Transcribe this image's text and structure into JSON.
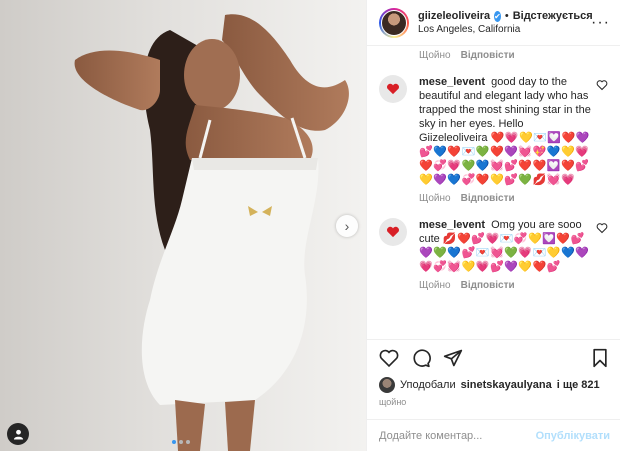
{
  "post": {
    "photo_alt": "photo",
    "carousel": {
      "count": 3,
      "active": 0
    }
  },
  "header": {
    "username": "giizeleoliveira",
    "verified_mark": "✔",
    "separator": "•",
    "follow_status": "Відстежується",
    "location": "Los Angeles, California",
    "more_label": "···"
  },
  "caption_meta": {
    "time": "Щойно",
    "reply": "Відповісти"
  },
  "comments": [
    {
      "username": "mese_levent",
      "text": "good day to the beautiful and elegant lady who has trapped the most shining star in the sky in her eyes. Hello Giizeleoliveira",
      "emojis": "❤️💗💛💌💟❤️💜💕💙❤️💌💚❤️💜💓💖💙💛💗❤️💞💗💚💙💓💕❤️❤️💟❤️💕💛💜💙💞❤️💛💕💚💋💓💗",
      "time": "Щойно",
      "reply": "Відповісти"
    },
    {
      "username": "mese_levent",
      "text": "Omg you are sooo cute",
      "emojis": "💋❤️💕💗💌💞💛💟❤️💕💜💚💙💕💌💓💚💗💌💛💙💜💗💞💓💛💗💕💜💛❤️💕",
      "time": "Щойно",
      "reply": "Відповісти"
    }
  ],
  "icons": [
    "heart-icon",
    "comment-icon",
    "share-icon",
    "bookmark-icon",
    "user-tag-icon",
    "chevron-right-icon",
    "verified-icon"
  ],
  "likes": {
    "prefix": "Уподобали",
    "user": "sinetskayaulyana",
    "suffix": "і ще 821"
  },
  "time_ago": "щойно",
  "add_comment": {
    "placeholder": "Додайте коментар...",
    "publish_label": "Опублікувати"
  },
  "colors": {
    "accent": "#3897f0",
    "publish_disabled": "#b2dffc",
    "muted": "#8e8e8e",
    "text": "#262626"
  }
}
